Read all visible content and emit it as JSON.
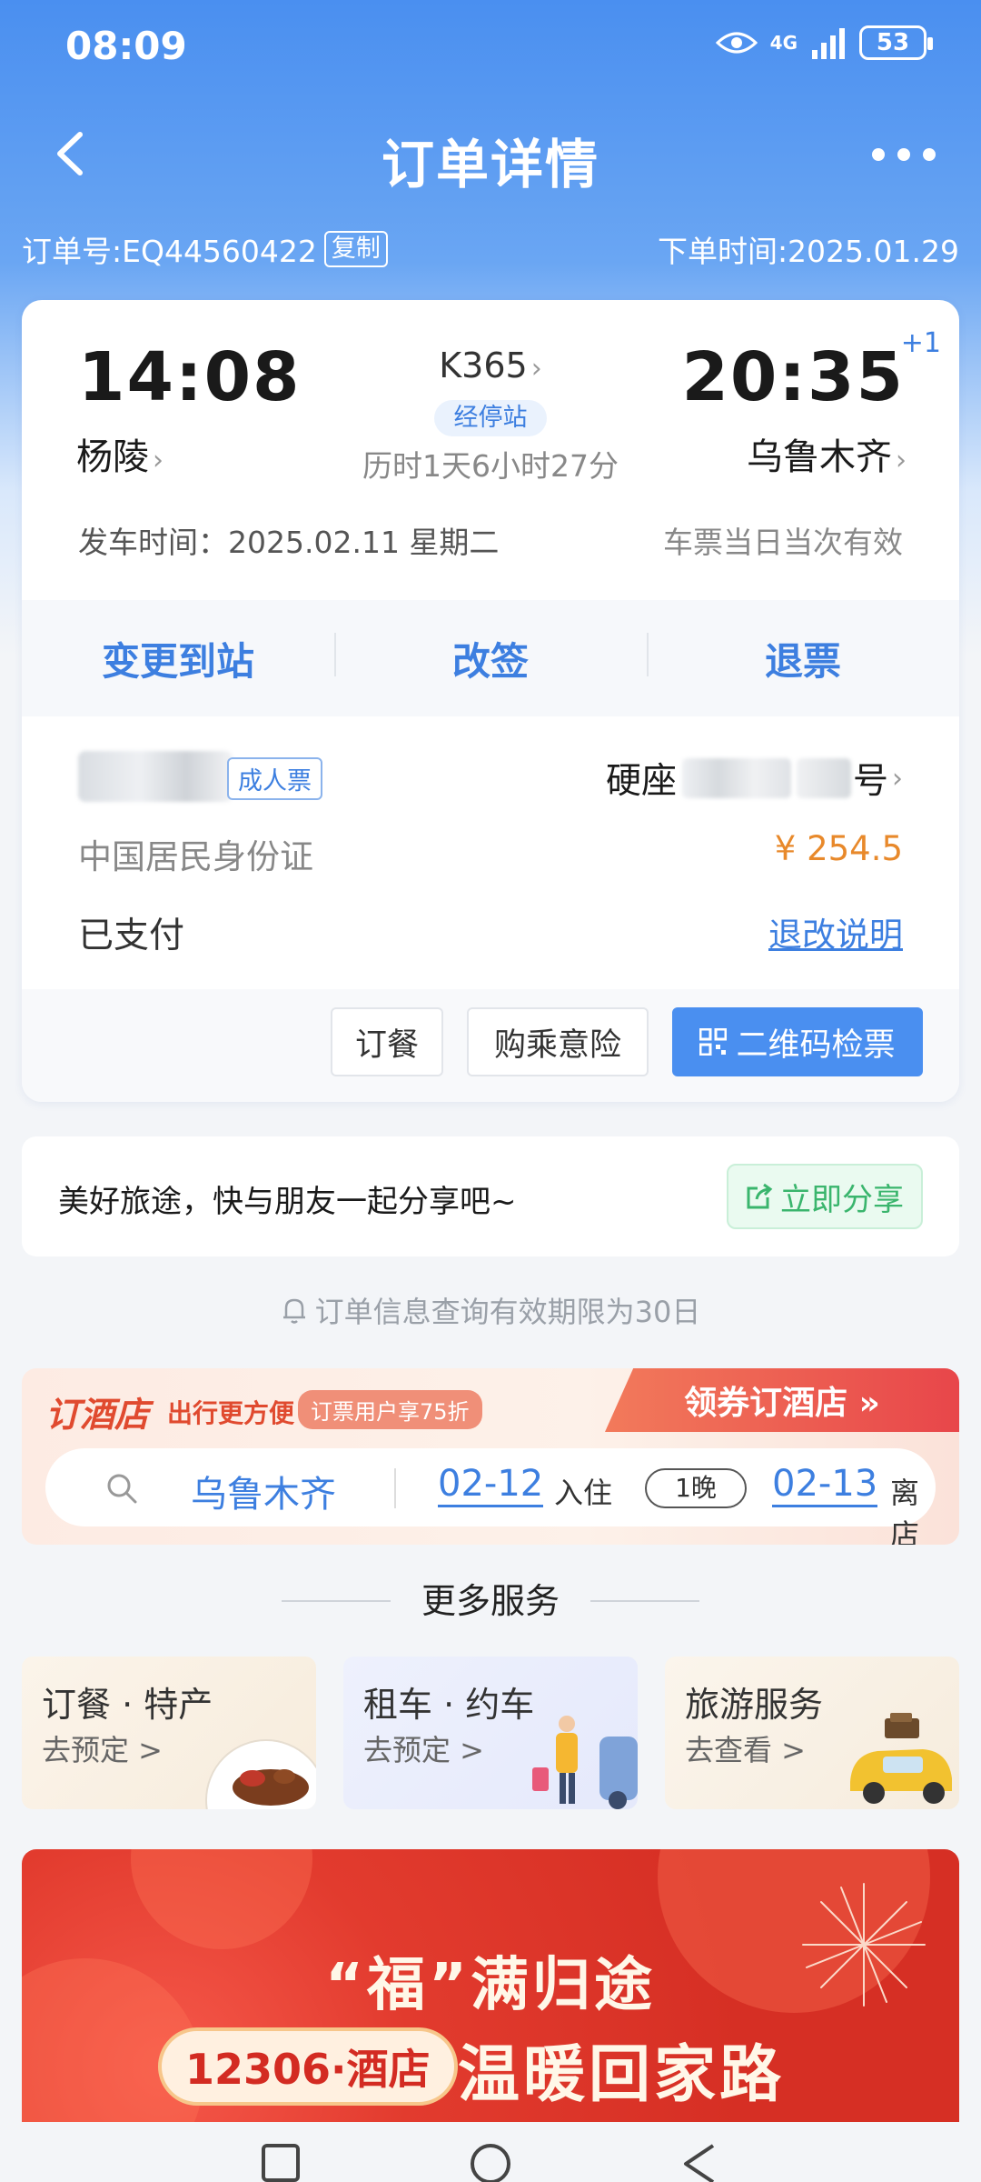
{
  "status_bar": {
    "time": "08:09",
    "network": "4G",
    "battery": "53"
  },
  "header": {
    "title": "订单详情"
  },
  "order": {
    "number_label": "订单号:EQ44560422",
    "copy_label": "复制",
    "order_time_label": "下单时间:2025.01.29"
  },
  "trip": {
    "departure_time": "14:08",
    "departure_station": "杨陵",
    "arrival_time": "20:35",
    "arrival_day_offset": "+1",
    "arrival_station": "乌鲁木齐",
    "train_number": "K365",
    "stops_label": "经停站",
    "duration": "历时1天6小时27分",
    "departure_date": "发车时间：2025.02.11 星期二",
    "validity": "车票当日当次有效"
  },
  "actions": [
    "变更到站",
    "改签",
    "退票"
  ],
  "passenger": {
    "ticket_type": "成人票",
    "seat_class": "硬座",
    "seat_suffix": "号",
    "id_type": "中国居民身份证",
    "price": "¥ 254.5",
    "payment_status": "已支付",
    "refund_info_link": "退改说明"
  },
  "card_buttons": {
    "meal": "订餐",
    "insurance": "购乘意险",
    "qr_check": "二维码检票"
  },
  "share": {
    "text": "美好旅途，快与朋友一起分享吧~",
    "button": "立即分享"
  },
  "validity_note": "订单信息查询有效期限为30日",
  "hotel": {
    "title": "订酒店",
    "subtitle": "出行更方便",
    "badge": "订票用户享75折",
    "cta": "领券订酒店 »",
    "city": "乌鲁木齐",
    "checkin_date": "02-12",
    "checkin_label": "入住",
    "nights": "1晚",
    "checkout_date": "02-13",
    "checkout_label": "离店"
  },
  "more_services": {
    "title": "更多服务",
    "items": [
      {
        "name": "订餐 · 特产",
        "link": "去预定 >"
      },
      {
        "name": "租车 · 约车",
        "link": "去预定 >"
      },
      {
        "name": "旅游服务",
        "link": "去查看 >"
      }
    ]
  },
  "banner": {
    "title": "“福”满归途",
    "tag": "12306·酒店",
    "slogan": "温暖回家路"
  },
  "colors": {
    "primary_blue": "#4a8ff0",
    "price_orange": "#e8892b",
    "banner_red": "#d62f24",
    "share_green": "#3ab56d"
  }
}
